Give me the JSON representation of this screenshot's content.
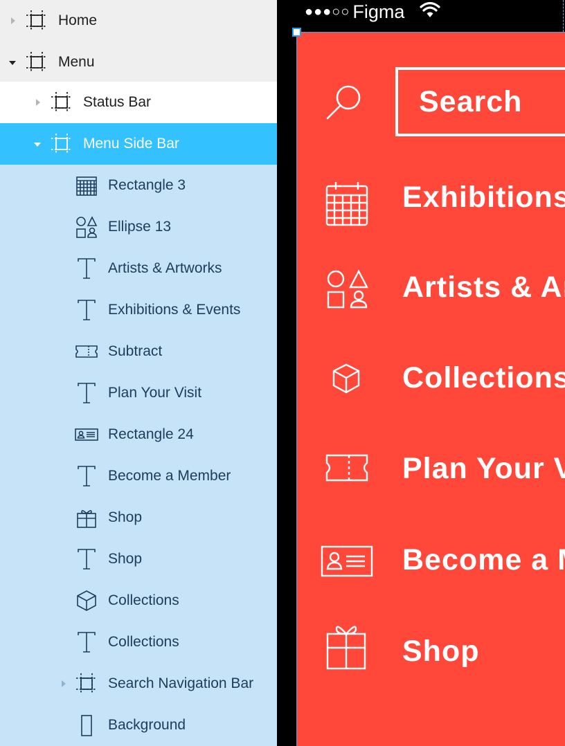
{
  "layers": [
    {
      "label": "Home",
      "icon": "frame-icon"
    },
    {
      "label": "Menu",
      "icon": "frame-icon"
    },
    {
      "label": "Status Bar",
      "icon": "frame-icon"
    },
    {
      "label": "Menu Side Bar",
      "icon": "frame-icon"
    },
    {
      "label": "Rectangle 3",
      "icon": "calendar-icon"
    },
    {
      "label": "Ellipse 13",
      "icon": "shapes-icon"
    },
    {
      "label": "Artists & Artworks",
      "icon": "text-icon"
    },
    {
      "label": "Exhibitions & Events",
      "icon": "text-icon"
    },
    {
      "label": "Subtract",
      "icon": "ticket-icon"
    },
    {
      "label": "Plan Your Visit",
      "icon": "text-icon"
    },
    {
      "label": "Rectangle 24",
      "icon": "member-card-icon"
    },
    {
      "label": "Become a Member",
      "icon": "text-icon"
    },
    {
      "label": "Shop",
      "icon": "gift-icon"
    },
    {
      "label": "Shop",
      "icon": "text-icon"
    },
    {
      "label": "Collections",
      "icon": "cube-icon"
    },
    {
      "label": "Collections",
      "icon": "text-icon"
    },
    {
      "label": "Search Navigation Bar",
      "icon": "frame-icon"
    },
    {
      "label": "Background",
      "icon": "rectangle-icon"
    }
  ],
  "status_bar": {
    "signal": "●●●○○",
    "carrier": "Figma",
    "icon": "wifi-icon"
  },
  "menu": {
    "search_label": "Search",
    "items": [
      {
        "label": "Exhibitions & Events",
        "icon": "calendar-icon"
      },
      {
        "label": "Artists & Artworks",
        "icon": "shapes-icon"
      },
      {
        "label": "Collections",
        "icon": "cube-icon"
      },
      {
        "label": "Plan Your Visit",
        "icon": "ticket-icon"
      },
      {
        "label": "Become a Member",
        "icon": "member-card-icon"
      },
      {
        "label": "Shop",
        "icon": "gift-icon"
      }
    ]
  },
  "colors": {
    "menu_background": "#ff473a",
    "selected_layer": "#33c1ff",
    "layer_panel": "#c7e3f8"
  }
}
